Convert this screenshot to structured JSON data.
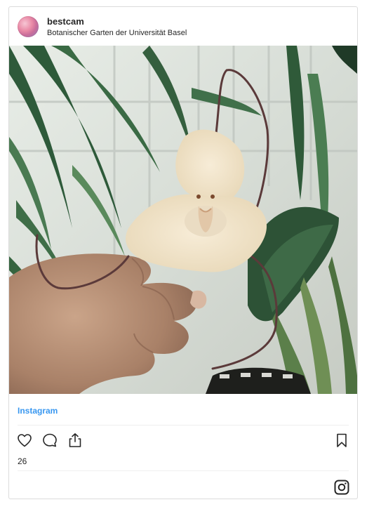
{
  "post": {
    "username": "bestcam",
    "location": "Botanischer Garten der Universität Basel",
    "source_link": "Instagram",
    "likes": "26"
  },
  "icons": {
    "like": "heart-icon",
    "comment": "comment-icon",
    "share": "share-icon",
    "save": "bookmark-icon",
    "brand": "instagram-logo-icon"
  },
  "colors": {
    "link": "#3897f0",
    "text": "#262626",
    "border": "#dbdbdb"
  }
}
